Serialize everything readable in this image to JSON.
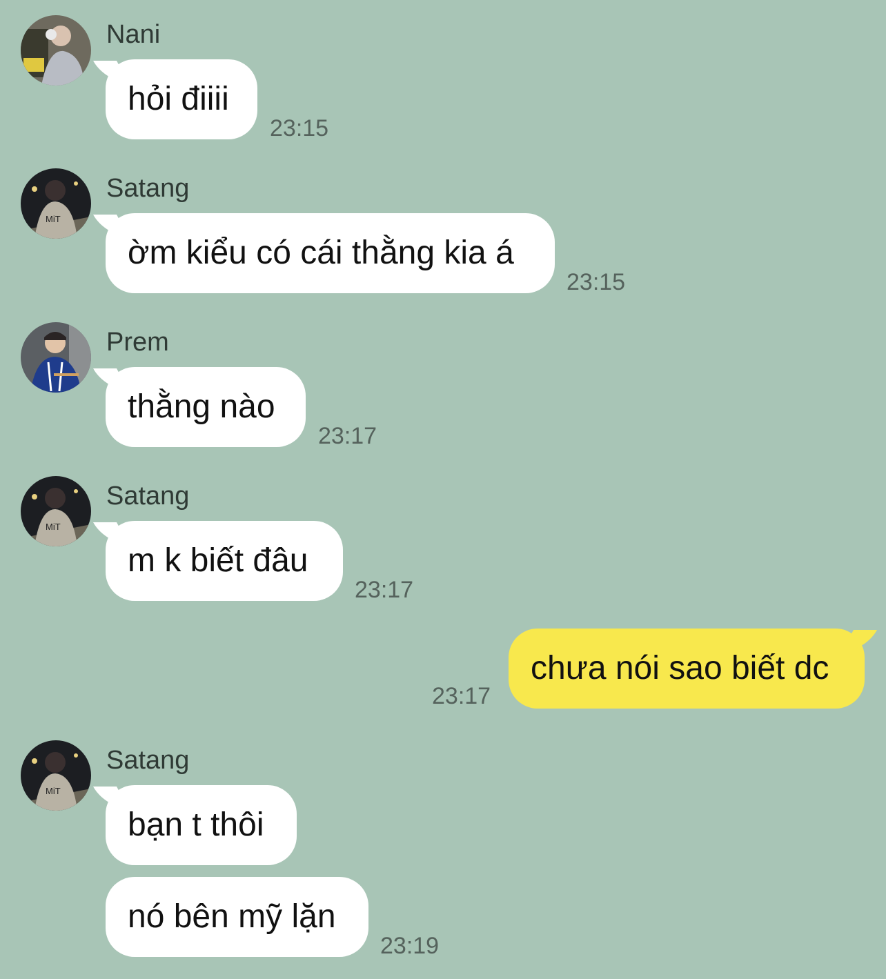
{
  "messages": [
    {
      "sender": "Nani",
      "text": "hỏi điiii",
      "time": "23:15",
      "avatar": "nani-avatar"
    },
    {
      "sender": "Satang",
      "text": "ờm kiểu có cái thằng kia á",
      "time": "23:15",
      "avatar": "satang-avatar"
    },
    {
      "sender": "Prem",
      "text": "thằng nào",
      "time": "23:17",
      "avatar": "prem-avatar"
    },
    {
      "sender": "Satang",
      "text": "m k biết đâu",
      "time": "23:17",
      "avatar": "satang-avatar"
    },
    {
      "sender": "me",
      "text": "chưa nói sao biết dc",
      "time": "23:17"
    },
    {
      "sender": "Satang",
      "text": "bạn t thôi",
      "avatar": "satang-avatar"
    },
    {
      "sender": "Satang",
      "text": "nó bên mỹ lặn",
      "time": "23:19"
    }
  ],
  "colors": {
    "background": "#a8c5b6",
    "incoming_bubble": "#ffffff",
    "outgoing_bubble": "#f8e84d",
    "timestamp": "#55625c"
  }
}
